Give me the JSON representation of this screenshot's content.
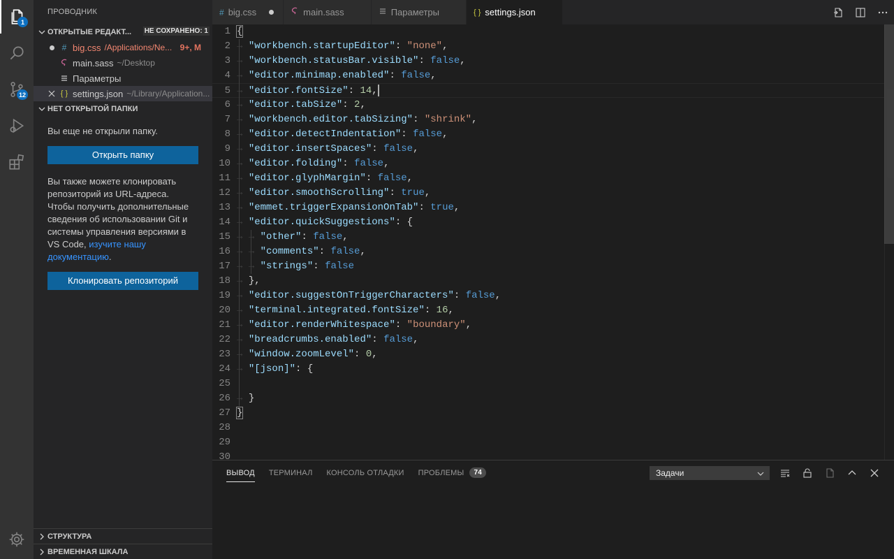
{
  "activity_bar": {
    "explorer_badge": "1",
    "scm_badge": "12"
  },
  "sidebar": {
    "title": "ПРОВОДНИК",
    "open_editors": {
      "header": "ОТКРЫТЫЕ РЕДАКТ...",
      "unsaved_badge": "НЕ СОХРАНЕНО: 1",
      "items": [
        {
          "name": "big.css",
          "icon": "#",
          "path": "/Applications/Ne...",
          "status": "9+, M"
        },
        {
          "name": "main.sass",
          "icon": "sass-icon",
          "path": "~/Desktop",
          "status": ""
        },
        {
          "name": "Параметры",
          "icon": "settings-icon",
          "path": "",
          "status": ""
        },
        {
          "name": "settings.json",
          "icon": "{ }",
          "path": "~/Library/Application...",
          "status": ""
        }
      ]
    },
    "no_folder": {
      "header": "НЕТ ОТКРЫТОЙ ПАПКИ",
      "message": "Вы еще не открыли папку.",
      "open_button": "Открыть папку",
      "clone_text": "Вы также можете клонировать репозиторий из URL-адреса. Чтобы получить дополнительные сведения об использовании Git и системы управления версиями в VS Code, ",
      "clone_link": "изучите нашу документацию",
      "clone_end": ".",
      "clone_button": "Клонировать репозиторий"
    },
    "outline_header": "СТРУКТУРА",
    "timeline_header": "ВРЕМЕННАЯ ШКАЛА"
  },
  "tabs": [
    {
      "label": "big.css",
      "icon": "#",
      "dirty": true
    },
    {
      "label": "main.sass",
      "icon": "sass",
      "dirty": false
    },
    {
      "label": "Параметры",
      "icon": "settings",
      "dirty": false
    },
    {
      "label": "settings.json",
      "icon": "{ }",
      "dirty": false,
      "active": true
    }
  ],
  "editor": {
    "cursor_line": 5,
    "lines": [
      {
        "n": "1",
        "indent": 0,
        "t": [
          [
            "p",
            "{"
          ]
        ]
      },
      {
        "n": "2",
        "indent": 1,
        "t": [
          [
            "k",
            "\"workbench.startupEditor\""
          ],
          [
            "p",
            ": "
          ],
          [
            "s",
            "\"none\""
          ],
          [
            "p",
            ","
          ]
        ]
      },
      {
        "n": "3",
        "indent": 1,
        "t": [
          [
            "k",
            "\"workbench.statusBar.visible\""
          ],
          [
            "p",
            ": "
          ],
          [
            "b",
            "false"
          ],
          [
            "p",
            ","
          ]
        ]
      },
      {
        "n": "4",
        "indent": 1,
        "t": [
          [
            "k",
            "\"editor.minimap.enabled\""
          ],
          [
            "p",
            ": "
          ],
          [
            "b",
            "false"
          ],
          [
            "p",
            ","
          ]
        ]
      },
      {
        "n": "5",
        "indent": 1,
        "t": [
          [
            "k",
            "\"editor.fontSize\""
          ],
          [
            "p",
            ": "
          ],
          [
            "n",
            "14"
          ],
          [
            "p",
            ","
          ]
        ]
      },
      {
        "n": "6",
        "indent": 1,
        "t": [
          [
            "k",
            "\"editor.tabSize\""
          ],
          [
            "p",
            ": "
          ],
          [
            "n",
            "2"
          ],
          [
            "p",
            ","
          ]
        ]
      },
      {
        "n": "7",
        "indent": 1,
        "t": [
          [
            "k",
            "\"workbench.editor.tabSizing\""
          ],
          [
            "p",
            ": "
          ],
          [
            "s",
            "\"shrink\""
          ],
          [
            "p",
            ","
          ]
        ]
      },
      {
        "n": "8",
        "indent": 1,
        "t": [
          [
            "k",
            "\"editor.detectIndentation\""
          ],
          [
            "p",
            ": "
          ],
          [
            "b",
            "false"
          ],
          [
            "p",
            ","
          ]
        ]
      },
      {
        "n": "9",
        "indent": 1,
        "t": [
          [
            "k",
            "\"editor.insertSpaces\""
          ],
          [
            "p",
            ": "
          ],
          [
            "b",
            "false"
          ],
          [
            "p",
            ","
          ]
        ]
      },
      {
        "n": "10",
        "indent": 1,
        "t": [
          [
            "k",
            "\"editor.folding\""
          ],
          [
            "p",
            ": "
          ],
          [
            "b",
            "false"
          ],
          [
            "p",
            ","
          ]
        ]
      },
      {
        "n": "11",
        "indent": 1,
        "t": [
          [
            "k",
            "\"editor.glyphMargin\""
          ],
          [
            "p",
            ": "
          ],
          [
            "b",
            "false"
          ],
          [
            "p",
            ","
          ]
        ]
      },
      {
        "n": "12",
        "indent": 1,
        "t": [
          [
            "k",
            "\"editor.smoothScrolling\""
          ],
          [
            "p",
            ": "
          ],
          [
            "b",
            "true"
          ],
          [
            "p",
            ","
          ]
        ]
      },
      {
        "n": "13",
        "indent": 1,
        "t": [
          [
            "k",
            "\"emmet.triggerExpansionOnTab\""
          ],
          [
            "p",
            ": "
          ],
          [
            "b",
            "true"
          ],
          [
            "p",
            ","
          ]
        ]
      },
      {
        "n": "14",
        "indent": 1,
        "t": [
          [
            "k",
            "\"editor.quickSuggestions\""
          ],
          [
            "p",
            ": {"
          ]
        ]
      },
      {
        "n": "15",
        "indent": 2,
        "t": [
          [
            "k",
            "\"other\""
          ],
          [
            "p",
            ": "
          ],
          [
            "b",
            "false"
          ],
          [
            "p",
            ","
          ]
        ]
      },
      {
        "n": "16",
        "indent": 2,
        "t": [
          [
            "k",
            "\"comments\""
          ],
          [
            "p",
            ": "
          ],
          [
            "b",
            "false"
          ],
          [
            "p",
            ","
          ]
        ]
      },
      {
        "n": "17",
        "indent": 2,
        "t": [
          [
            "k",
            "\"strings\""
          ],
          [
            "p",
            ": "
          ],
          [
            "b",
            "false"
          ]
        ]
      },
      {
        "n": "18",
        "indent": 1,
        "t": [
          [
            "p",
            "},"
          ]
        ]
      },
      {
        "n": "19",
        "indent": 1,
        "t": [
          [
            "k",
            "\"editor.suggestOnTriggerCharacters\""
          ],
          [
            "p",
            ": "
          ],
          [
            "b",
            "false"
          ],
          [
            "p",
            ","
          ]
        ]
      },
      {
        "n": "20",
        "indent": 1,
        "t": [
          [
            "k",
            "\"terminal.integrated.fontSize\""
          ],
          [
            "p",
            ": "
          ],
          [
            "n",
            "16"
          ],
          [
            "p",
            ","
          ]
        ]
      },
      {
        "n": "21",
        "indent": 1,
        "t": [
          [
            "k",
            "\"editor.renderWhitespace\""
          ],
          [
            "p",
            ": "
          ],
          [
            "s",
            "\"boundary\""
          ],
          [
            "p",
            ","
          ]
        ]
      },
      {
        "n": "22",
        "indent": 1,
        "t": [
          [
            "k",
            "\"breadcrumbs.enabled\""
          ],
          [
            "p",
            ": "
          ],
          [
            "b",
            "false"
          ],
          [
            "p",
            ","
          ]
        ]
      },
      {
        "n": "23",
        "indent": 1,
        "t": [
          [
            "k",
            "\"window.zoomLevel\""
          ],
          [
            "p",
            ": "
          ],
          [
            "n",
            "0"
          ],
          [
            "p",
            ","
          ]
        ]
      },
      {
        "n": "24",
        "indent": 1,
        "t": [
          [
            "k",
            "\"[json]\""
          ],
          [
            "p",
            ": {"
          ]
        ]
      },
      {
        "n": "25",
        "indent": 0,
        "t": []
      },
      {
        "n": "26",
        "indent": 1,
        "t": [
          [
            "p",
            "}"
          ]
        ]
      },
      {
        "n": "27",
        "indent": 0,
        "t": [
          [
            "p",
            "}"
          ]
        ]
      },
      {
        "n": "28",
        "indent": 0,
        "t": []
      },
      {
        "n": "29",
        "indent": 0,
        "t": []
      },
      {
        "n": "30",
        "indent": 0,
        "t": []
      }
    ]
  },
  "panel": {
    "tabs": [
      {
        "label": "ВЫВОД",
        "active": true
      },
      {
        "label": "ТЕРМИНАЛ"
      },
      {
        "label": "КОНСОЛЬ ОТЛАДКИ"
      },
      {
        "label": "ПРОБЛЕМЫ",
        "badge": "74"
      }
    ],
    "select_value": "Задачи"
  }
}
